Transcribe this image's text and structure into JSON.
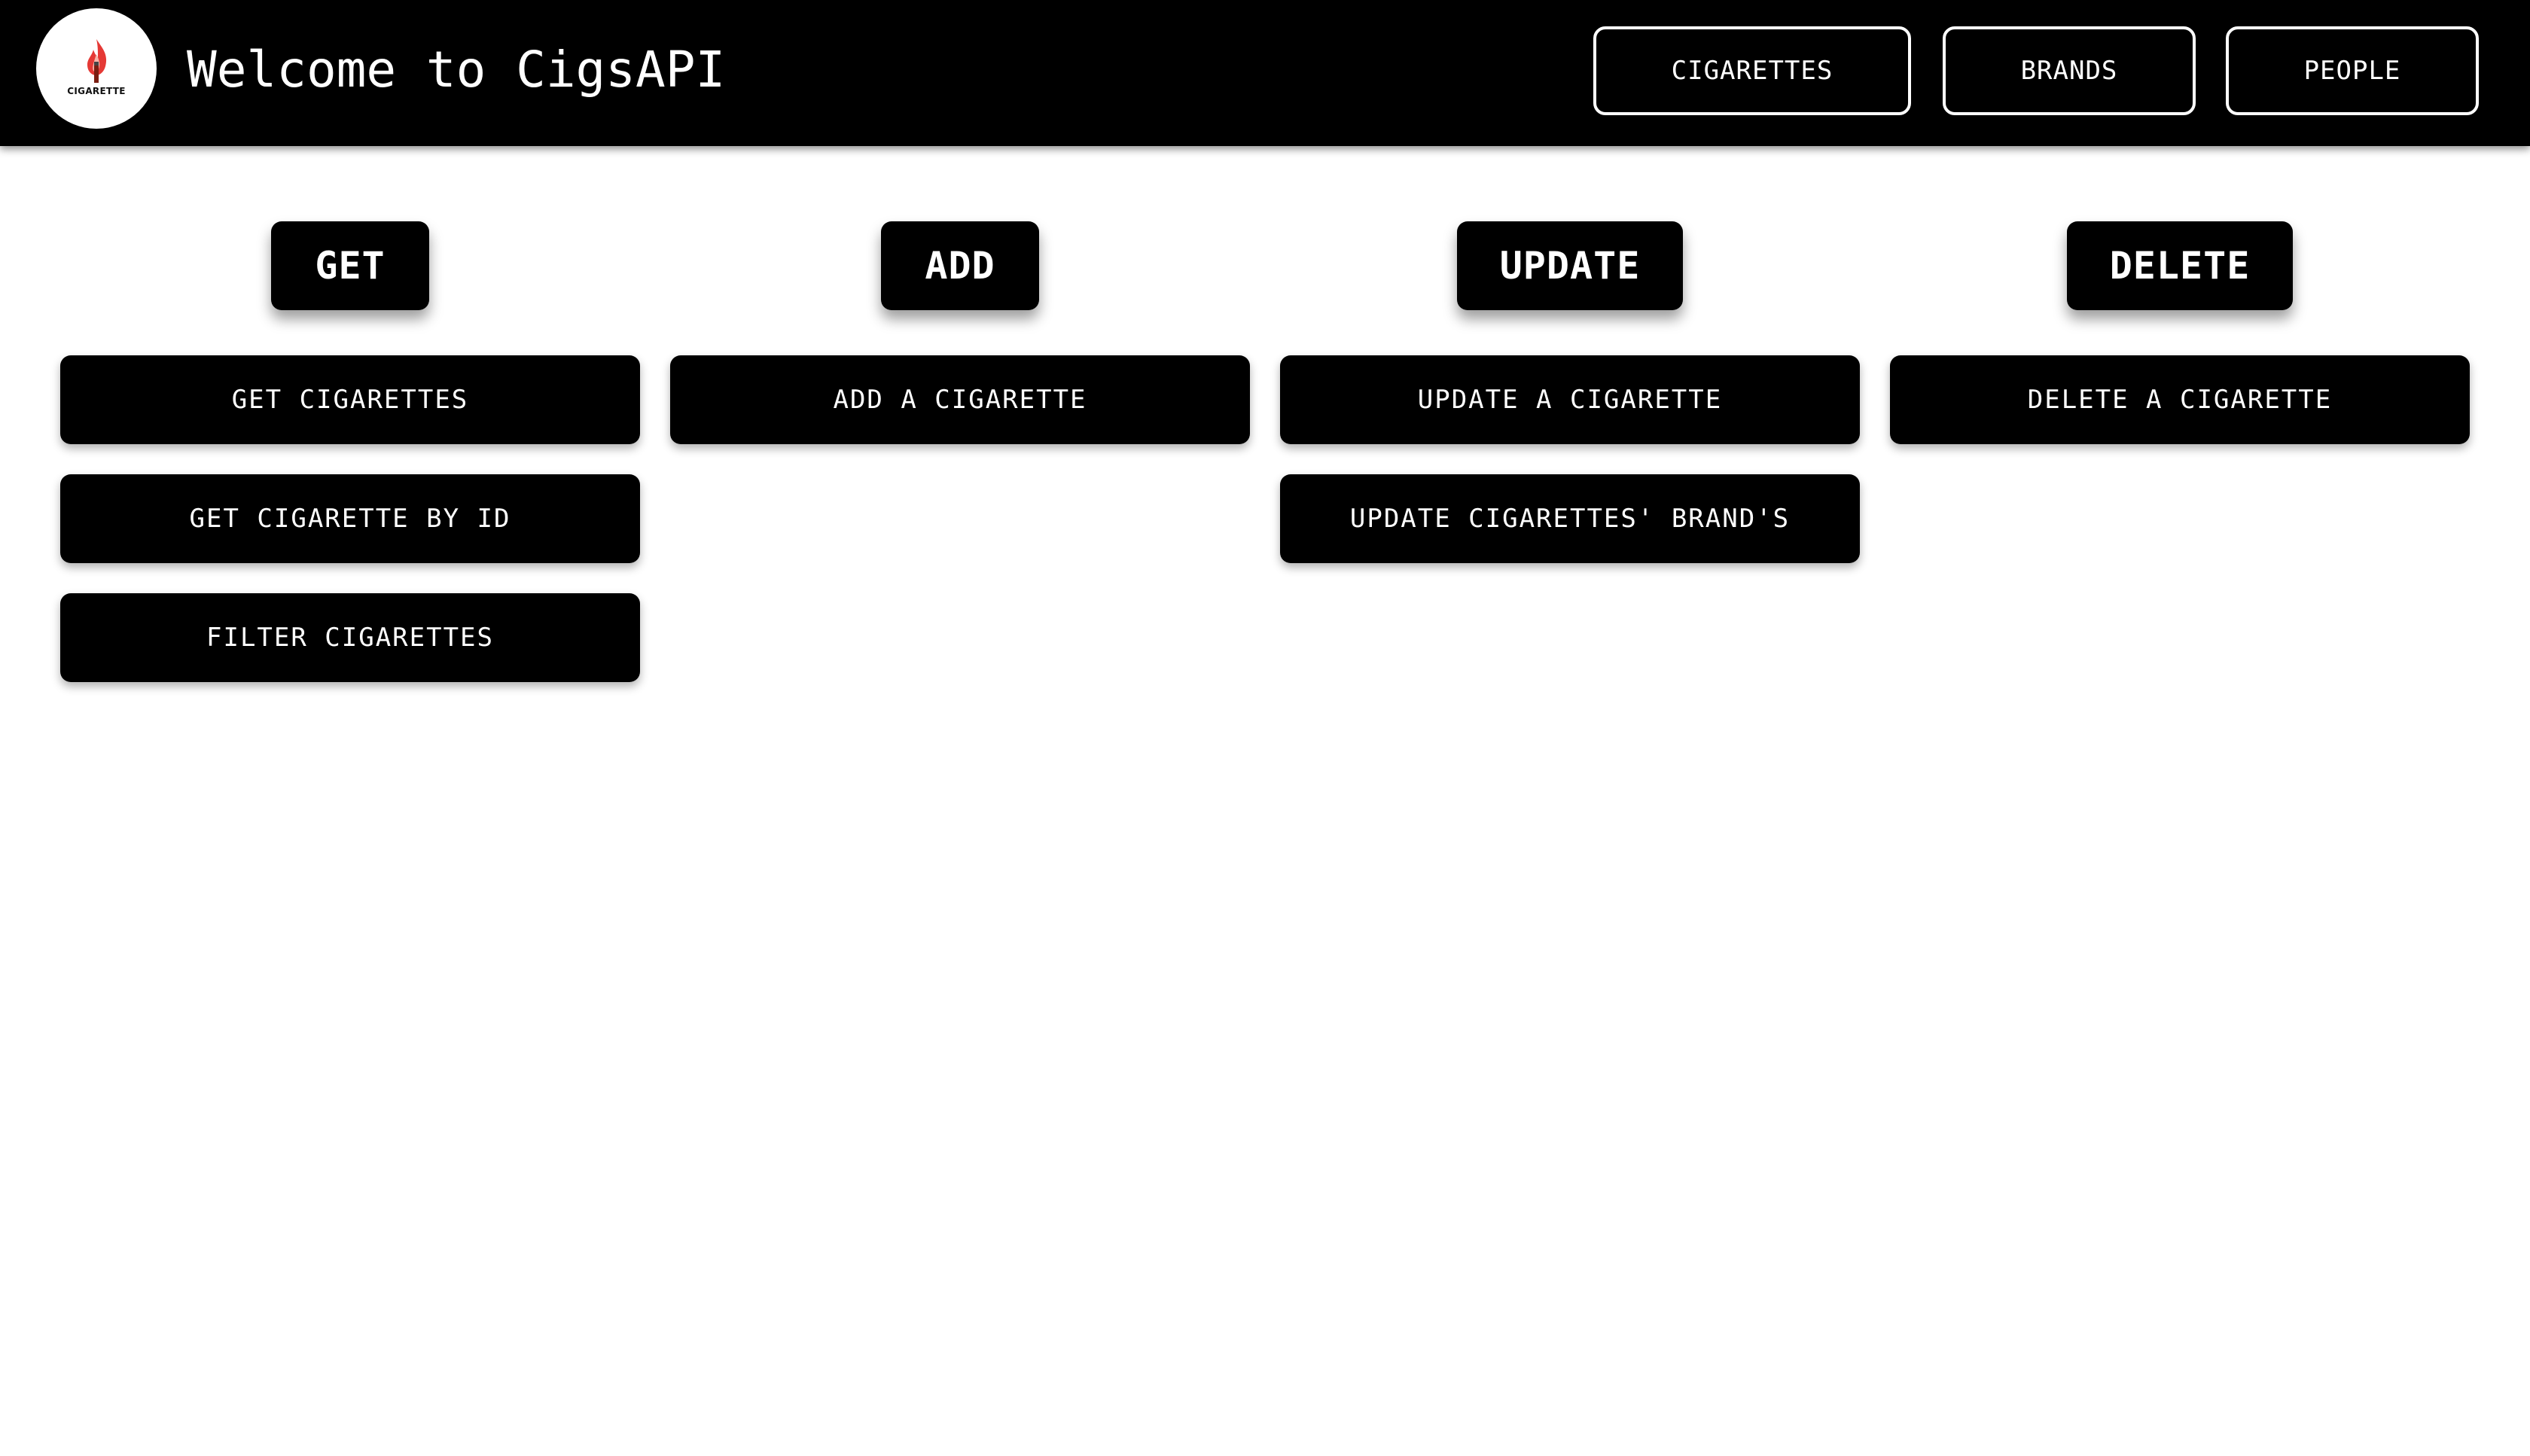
{
  "header": {
    "logo_text": "CIGARETTE",
    "logo_icon": "flame-cigarette-icon",
    "title": "Welcome to CigsAPI",
    "nav": [
      {
        "label": "CIGARETTES"
      },
      {
        "label": "BRANDS"
      },
      {
        "label": "PEOPLE"
      }
    ]
  },
  "columns": [
    {
      "heading": "GET",
      "actions": [
        "GET CIGARETTES",
        "GET CIGARETTE BY ID",
        "FILTER CIGARETTES"
      ]
    },
    {
      "heading": "ADD",
      "actions": [
        "ADD A CIGARETTE"
      ]
    },
    {
      "heading": "UPDATE",
      "actions": [
        "UPDATE A CIGARETTE",
        "UPDATE CIGARETTES' BRAND'S"
      ]
    },
    {
      "heading": "DELETE",
      "actions": [
        "DELETE A CIGARETTE"
      ]
    }
  ],
  "colors": {
    "background": "#ffffff",
    "bar": "#000000",
    "text": "#ffffff",
    "flame": "#e53935"
  }
}
